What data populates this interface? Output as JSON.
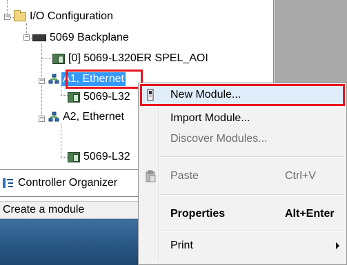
{
  "tree": {
    "nodes": [
      {
        "label": "I/O Configuration",
        "icon": "folder-icon"
      },
      {
        "label": "5069 Backplane",
        "icon": "backplane-icon"
      },
      {
        "label": "[0] 5069-L320ER SPEL_AOI",
        "icon": "module-icon"
      },
      {
        "label": "A1, Ethernet",
        "icon": "network-icon",
        "selected": true
      },
      {
        "label": "5069-L32",
        "icon": "module-icon"
      },
      {
        "label": "A2, Ethernet",
        "icon": "network-icon"
      },
      {
        "label": "5069-L32",
        "icon": "module-icon"
      }
    ],
    "expand_symbol": "−"
  },
  "tab_bar": {
    "label": "Controller Organizer",
    "icon": "organizer-icon"
  },
  "status": {
    "text": "Create a module"
  },
  "context_menu": {
    "items": [
      {
        "label": "New Module...",
        "icon": "new-module-icon",
        "highlighted": true
      },
      {
        "label": "Import Module..."
      },
      {
        "label": "Discover Modules...",
        "disabled": true
      },
      {
        "label": "Paste",
        "shortcut": "Ctrl+V",
        "icon": "paste-icon",
        "disabled": true
      },
      {
        "label": "Properties",
        "shortcut": "Alt+Enter",
        "bold": true
      },
      {
        "label": "Print",
        "has_submenu": true
      }
    ]
  },
  "colors": {
    "selection": "#3399ff",
    "annotation_box": "#e8141e",
    "menu_highlight": "#e0edfa"
  }
}
